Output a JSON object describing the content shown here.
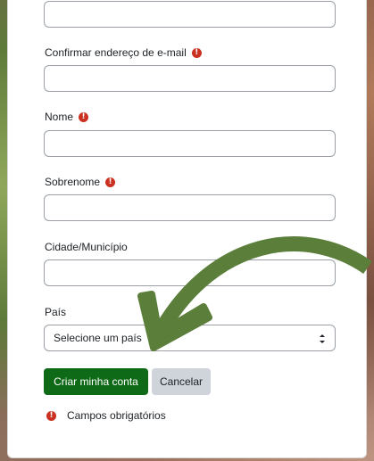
{
  "form": {
    "fields": [
      {
        "label": "",
        "value": "",
        "required": false
      },
      {
        "label": "Confirmar endereço de e-mail",
        "value": "",
        "required": true
      },
      {
        "label": "Nome",
        "value": "",
        "required": true
      },
      {
        "label": "Sobrenome",
        "value": "",
        "required": true
      },
      {
        "label": "Cidade/Município",
        "value": "",
        "required": false
      }
    ],
    "country": {
      "label": "País",
      "selected": "Selecione um país"
    },
    "submit_label": "Criar minha conta",
    "cancel_label": "Cancelar",
    "required_note": "Campos obrigatórios",
    "required_icon": "!"
  },
  "colors": {
    "primary_button": "#0f6a17",
    "required_icon": "#ca3120",
    "arrow": "#5b7f3b"
  }
}
